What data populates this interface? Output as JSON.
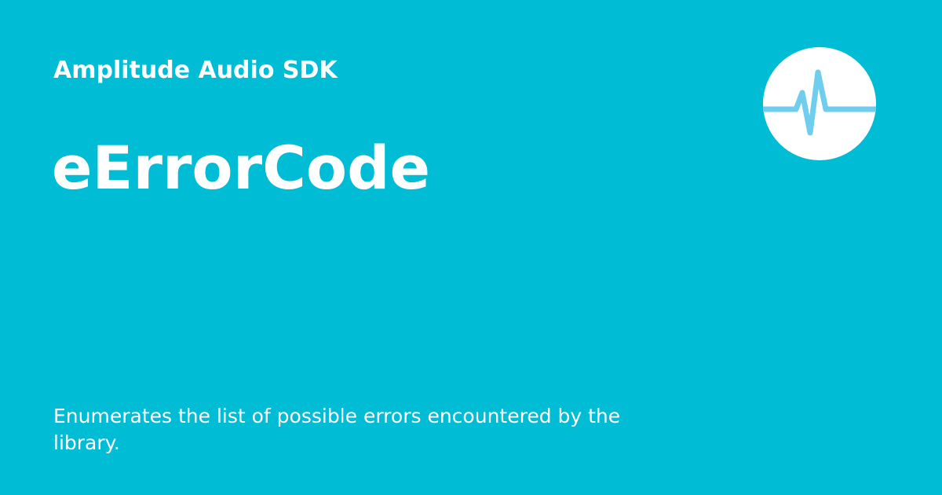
{
  "header": {
    "site_name": "Amplitude Audio SDK",
    "logo_icon": "audio-waveform-icon"
  },
  "main": {
    "title": "eErrorCode",
    "description": "Enumerates the list of possible errors encountered by the library."
  },
  "colors": {
    "background": "#00BCD4",
    "text": "#FFFFFF",
    "logo_circle": "#FFFFFF",
    "logo_wave": "#6FCDEE"
  }
}
